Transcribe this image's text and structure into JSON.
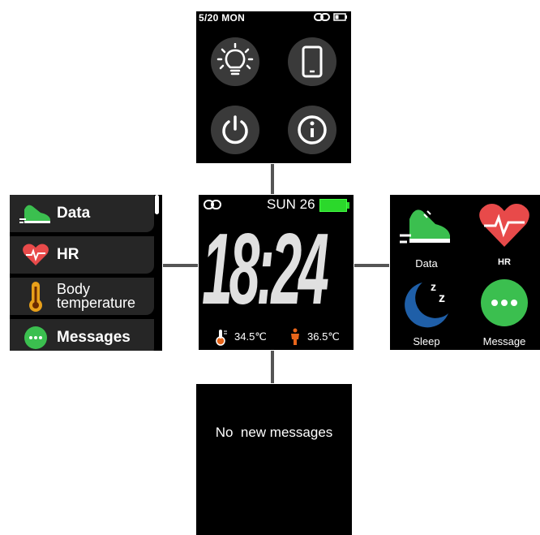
{
  "top_screen": {
    "status_date": "5/20 MON",
    "buttons": [
      {
        "name": "brightness",
        "icon": "bulb-icon"
      },
      {
        "name": "phone",
        "icon": "phone-icon"
      },
      {
        "name": "power",
        "icon": "power-icon"
      },
      {
        "name": "info",
        "icon": "info-icon"
      }
    ]
  },
  "center_screen": {
    "date": "SUN 26",
    "time": "18:24",
    "temp_body": "34.5℃",
    "temp_ambient": "36.5℃",
    "battery_color": "#2bd82b"
  },
  "left_screen": {
    "items": [
      {
        "label": "Data",
        "icon": "shoe-icon"
      },
      {
        "label": "HR",
        "icon": "heart-icon"
      },
      {
        "label_line1": "Body",
        "label_line2": "temperature",
        "icon": "thermometer-icon"
      },
      {
        "label": "Messages",
        "icon": "message-icon"
      }
    ]
  },
  "right_screen": {
    "apps": [
      {
        "label": "Data",
        "icon": "shoe-icon"
      },
      {
        "label": "HR",
        "icon": "heart-icon"
      },
      {
        "label": "Sleep",
        "icon": "moon-icon"
      },
      {
        "label": "Message",
        "icon": "message-icon"
      }
    ]
  },
  "bottom_screen": {
    "message": "No  new messages"
  }
}
